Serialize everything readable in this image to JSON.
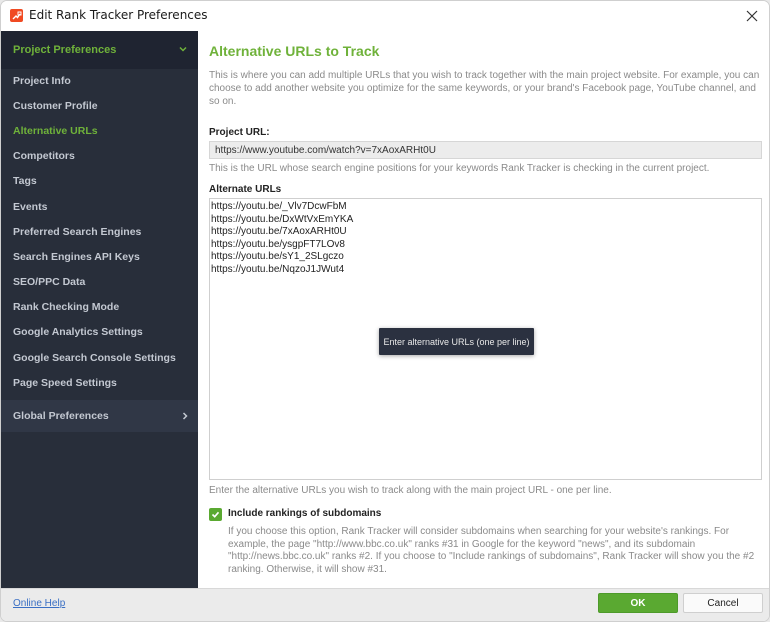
{
  "window": {
    "title": "Edit Rank Tracker Preferences",
    "app_icon": "rank-tracker-logo-icon",
    "close_icon": "close-icon"
  },
  "sidebar": {
    "section_label": "Project Preferences",
    "section_icon": "chevron-down-icon",
    "items": [
      {
        "label": "Project Info",
        "active": false
      },
      {
        "label": "Customer Profile",
        "active": false
      },
      {
        "label": "Alternative URLs",
        "active": true
      },
      {
        "label": "Competitors",
        "active": false
      },
      {
        "label": "Tags",
        "active": false
      },
      {
        "label": "Events",
        "active": false
      },
      {
        "label": "Preferred Search Engines",
        "active": false
      },
      {
        "label": "Search Engines API Keys",
        "active": false
      },
      {
        "label": "SEO/PPC Data",
        "active": false
      },
      {
        "label": "Rank Checking Mode",
        "active": false
      },
      {
        "label": "Google Analytics Settings",
        "active": false
      },
      {
        "label": "Google Search Console Settings",
        "active": false
      },
      {
        "label": "Page Speed Settings",
        "active": false
      }
    ],
    "global_label": "Global Preferences",
    "global_icon": "chevron-right-icon"
  },
  "content": {
    "title": "Alternative URLs to Track",
    "intro": "This is where you can add multiple URLs that you wish to track together with the main project website. For example, you can choose to add another website you optimize for the same keywords, or your brand's Facebook page, YouTube channel, and so on.",
    "project_url_label": "Project URL:",
    "project_url_value": "https://www.youtube.com/watch?v=7xAoxARHt0U",
    "project_url_hint": "This is the URL whose search engine positions for your keywords Rank Tracker is checking in the current project.",
    "alt_urls_label": "Alternate URLs",
    "alt_urls": [
      "https://youtu.be/_Vlv7DcwFbM",
      "https://youtu.be/DxWtVxEmYKA",
      "https://youtu.be/7xAoxARHt0U",
      "https://youtu.be/ysgpFT7LOv8",
      "https://youtu.be/sY1_2SLgczo",
      "https://youtu.be/NqzoJ1JWut4"
    ],
    "tooltip": "Enter alternative URLs (one per line)",
    "alt_urls_hint": "Enter the alternative URLs you wish to track along with the main project URL - one per line.",
    "subdomains_checked": true,
    "subdomains_label": "Include rankings of subdomains",
    "subdomains_desc": "If you choose this option, Rank Tracker will consider subdomains when searching for your website's rankings. For example, the page \"http://www.bbc.co.uk\" ranks #31 in Google for the keyword \"news\", and its subdomain \"http://news.bbc.co.uk\" ranks #2. If you choose to \"Include rankings of subdomains\", Rank Tracker will show you the #2 ranking. Otherwise, it will show #31."
  },
  "footer": {
    "help_link": "Online Help",
    "ok_label": "OK",
    "cancel_label": "Cancel"
  },
  "colors": {
    "accent_green": "#6fb23a",
    "button_green": "#5aa931",
    "sidebar_bg": "#282e3a",
    "link_blue": "#3a6fc4"
  }
}
